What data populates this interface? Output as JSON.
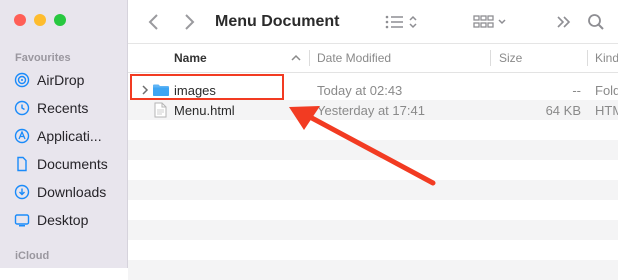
{
  "window": {
    "title": "Menu Document"
  },
  "colors": {
    "close": "#ff5f57",
    "minimize": "#febc2e",
    "zoom": "#28c840",
    "accent": "#1a8bfa",
    "annotation": "#f23b22"
  },
  "sidebar": {
    "favourites_header": "Favourites",
    "items": [
      {
        "label": "AirDrop",
        "icon": "airdrop-icon"
      },
      {
        "label": "Recents",
        "icon": "clock-icon"
      },
      {
        "label": "Applicati...",
        "icon": "applications-icon"
      },
      {
        "label": "Documents",
        "icon": "document-icon"
      },
      {
        "label": "Downloads",
        "icon": "download-icon"
      },
      {
        "label": "Desktop",
        "icon": "desktop-icon"
      }
    ],
    "icloud_header": "iCloud"
  },
  "columns": {
    "name": "Name",
    "date": "Date Modified",
    "size": "Size",
    "kind": "Kind"
  },
  "files": [
    {
      "name": "images",
      "date": "Today at 02:43",
      "size": "--",
      "kind": "Fold",
      "icon": "folder-icon"
    },
    {
      "name": "Menu.html",
      "date": "Yesterday at 17:41",
      "size": "64 KB",
      "kind": "HTM",
      "icon": "html-file-icon"
    }
  ]
}
